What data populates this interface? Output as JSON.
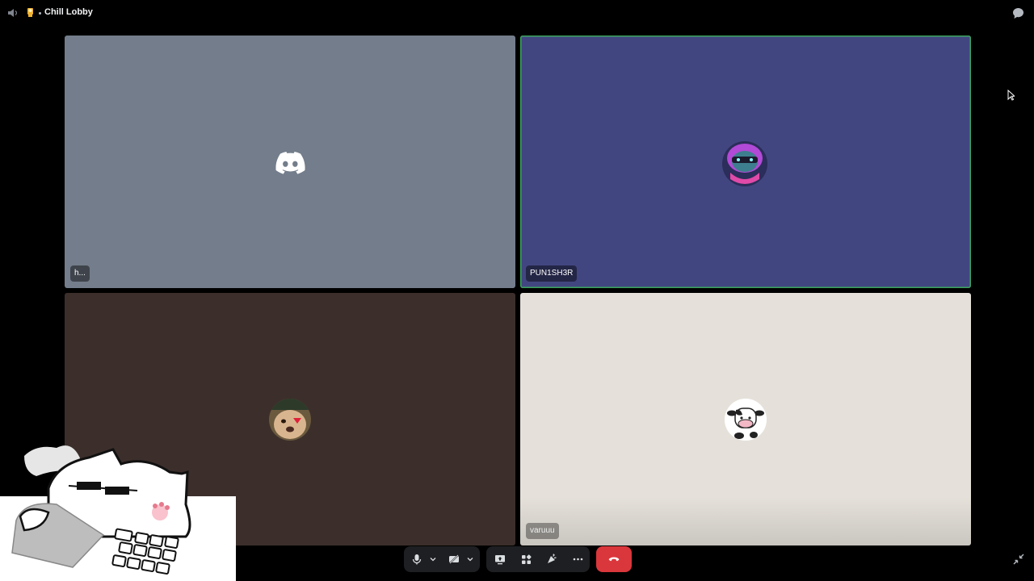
{
  "header": {
    "channel_name": "Chill Lobby",
    "speaker_icon": "speaker-icon",
    "crown_icon": "crown-icon",
    "chat_icon": "chat-bubble-icon"
  },
  "participants": [
    {
      "name": "h...",
      "avatar_icon": "discord-logo-icon",
      "speaking": false,
      "tile_color": "#737d8b"
    },
    {
      "name": "PUN1SH3R",
      "avatar_icon": "avatar",
      "speaking": true,
      "tile_color": "#424680"
    },
    {
      "name": "",
      "avatar_icon": "avatar",
      "speaking": false,
      "tile_color": "#3c2f2b"
    },
    {
      "name": "varuuu",
      "avatar_icon": "cow-avatar",
      "speaking": false,
      "tile_color": "#e5e1da"
    }
  ],
  "controls": {
    "icons": [
      "microphone-icon",
      "chevron-down-icon",
      "camera-off-icon",
      "chevron-down-icon",
      "screen-share-icon",
      "activities-icon",
      "soundboard-icon",
      "more-icon",
      "hang-up-icon"
    ],
    "hangup_color": "#da373c"
  },
  "colors": {
    "speaking_ring": "#3ba55c",
    "background": "#000000"
  }
}
